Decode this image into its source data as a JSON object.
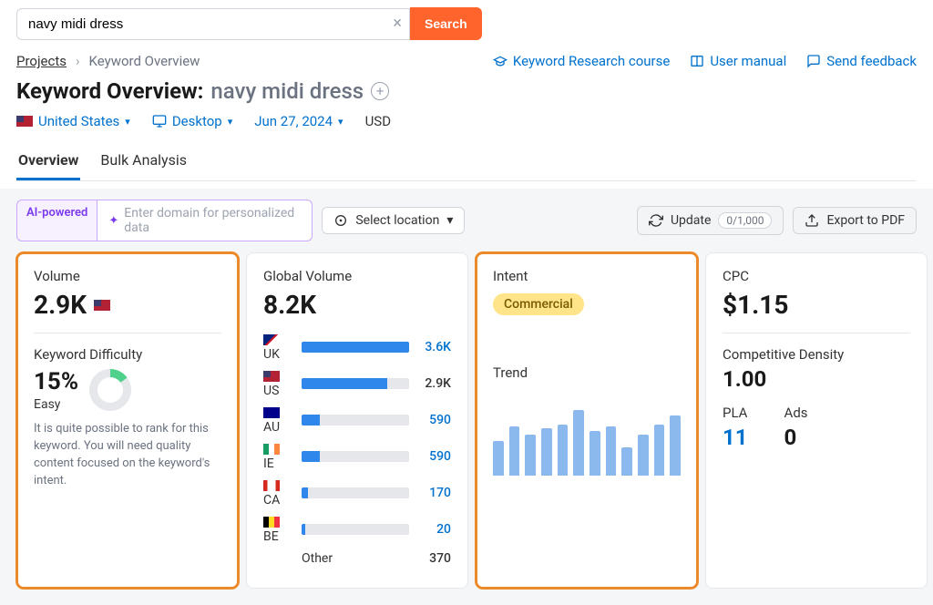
{
  "search": {
    "value": "navy midi dress",
    "button": "Search"
  },
  "breadcrumb": {
    "projects": "Projects",
    "current": "Keyword Overview"
  },
  "header_links": {
    "course": "Keyword Research course",
    "manual": "User manual",
    "feedback": "Send feedback"
  },
  "title": {
    "label": "Keyword Overview:",
    "keyword": "navy midi dress"
  },
  "filters": {
    "country": "United States",
    "device": "Desktop",
    "date": "Jun 27, 2024",
    "currency": "USD"
  },
  "tabs": {
    "overview": "Overview",
    "bulk": "Bulk Analysis"
  },
  "bar": {
    "ai": "AI-powered",
    "domain_placeholder": "Enter domain for personalized data",
    "select_location": "Select location",
    "update": "Update",
    "update_count": "0/1,000",
    "export": "Export to PDF"
  },
  "volume": {
    "label": "Volume",
    "value": "2.9K",
    "kd_label": "Keyword Difficulty",
    "kd_pct": "15%",
    "kd_level": "Easy",
    "kd_desc": "It is quite possible to rank for this keyword. You will need quality content focused on the keyword's intent."
  },
  "global": {
    "label": "Global Volume",
    "value": "8.2K",
    "rows": [
      {
        "cc": "UK",
        "val": "3.6K",
        "pct": 100,
        "flag": "flag-uk",
        "blue": true
      },
      {
        "cc": "US",
        "val": "2.9K",
        "pct": 80,
        "flag": "flag-us",
        "blue": false
      },
      {
        "cc": "AU",
        "val": "590",
        "pct": 17,
        "flag": "flag-au",
        "blue": true
      },
      {
        "cc": "IE",
        "val": "590",
        "pct": 17,
        "flag": "flag-ie",
        "blue": true
      },
      {
        "cc": "CA",
        "val": "170",
        "pct": 6,
        "flag": "flag-ca",
        "blue": true
      },
      {
        "cc": "BE",
        "val": "20",
        "pct": 3,
        "flag": "flag-be",
        "blue": true
      }
    ],
    "other_label": "Other",
    "other_val": "370"
  },
  "intent": {
    "label": "Intent",
    "value": "Commercial",
    "trend_label": "Trend"
  },
  "cpc": {
    "label": "CPC",
    "value": "$1.15",
    "cd_label": "Competitive Density",
    "cd_value": "1.00",
    "pla_label": "PLA",
    "pla_value": "11",
    "ads_label": "Ads",
    "ads_value": "0"
  },
  "chart_data": {
    "type": "bar",
    "categories": [
      "1",
      "2",
      "3",
      "4",
      "5",
      "6",
      "7",
      "8",
      "9",
      "10",
      "11",
      "12"
    ],
    "values": [
      42,
      60,
      50,
      58,
      62,
      80,
      55,
      60,
      35,
      50,
      62,
      73
    ],
    "title": "Trend",
    "xlabel": "",
    "ylabel": "",
    "ylim": [
      0,
      100
    ]
  }
}
